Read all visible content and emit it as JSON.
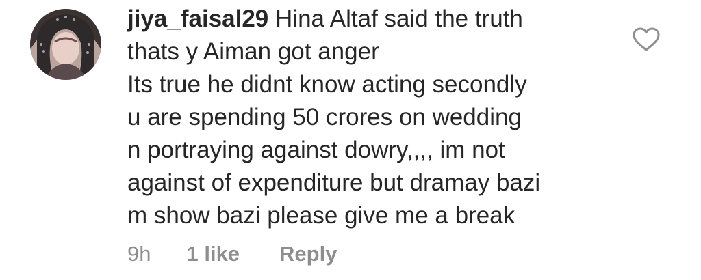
{
  "comment": {
    "username": "jiya_faisal29",
    "text_lines": [
      "Hina Altaf said the truth",
      "thats y Aiman got anger",
      "Its true he didnt know acting secondly",
      "u are spending 50 crores on wedding",
      "n portraying against dowry,,,, im not",
      "against of expenditure but dramay bazi",
      "m show bazi please give me a break"
    ],
    "time": "9h",
    "likes": "1 like",
    "reply_label": "Reply",
    "like_icon": "heart-outline-icon"
  },
  "colors": {
    "text": "#262626",
    "meta": "#8e8e8e",
    "icon": "#8e8e8e"
  }
}
